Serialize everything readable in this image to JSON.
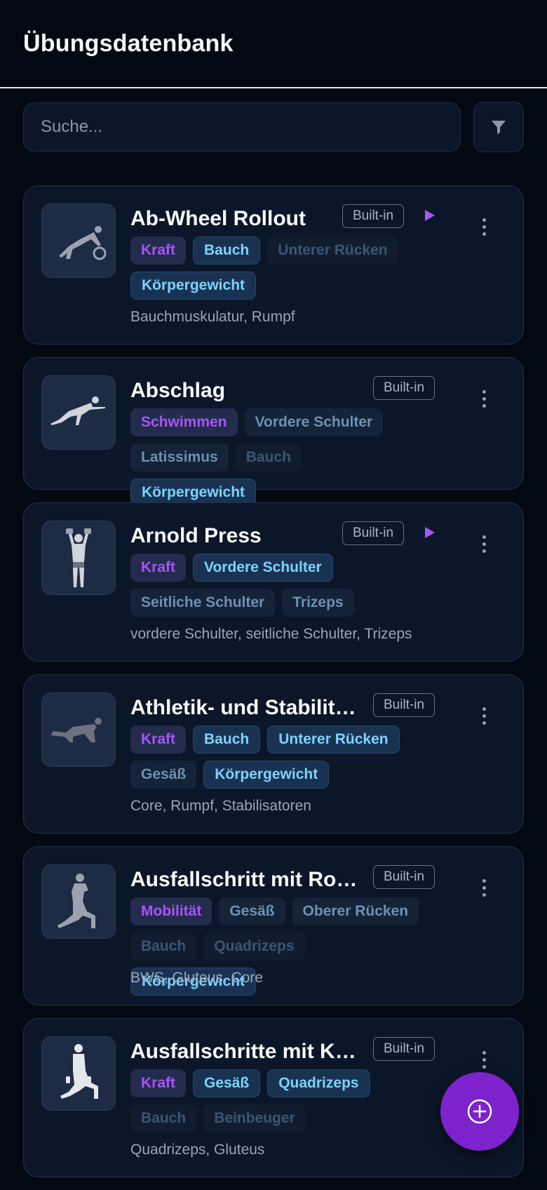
{
  "header": {
    "title": "Übungsdatenbank"
  },
  "search": {
    "placeholder": "Suche..."
  },
  "exercises": [
    {
      "name": "Ab-Wheel Rollout",
      "badge": "Built-in",
      "has_video": true,
      "tags": [
        {
          "label": "Kraft",
          "kind": "category"
        },
        {
          "label": "Bauch",
          "kind": "primary"
        },
        {
          "label": "Unterer Rücken",
          "kind": "tertiary"
        },
        {
          "label": "Körpergewicht",
          "kind": "primary"
        }
      ],
      "description": "Bauchmuskulatur, Rumpf",
      "icon": "ab-wheel-figure-icon"
    },
    {
      "name": "Abschlag",
      "badge": "Built-in",
      "has_video": false,
      "tags": [
        {
          "label": "Schwimmen",
          "kind": "category"
        },
        {
          "label": "Vordere Schulter",
          "kind": "secondary"
        },
        {
          "label": "Latissimus",
          "kind": "secondary"
        },
        {
          "label": "Bauch",
          "kind": "tertiary"
        },
        {
          "label": "Körpergewicht",
          "kind": "primary"
        }
      ],
      "description": "",
      "icon": "crawling-figure-icon"
    },
    {
      "name": "Arnold Press",
      "badge": "Built-in",
      "has_video": true,
      "tags": [
        {
          "label": "Kraft",
          "kind": "category"
        },
        {
          "label": "Vordere Schulter",
          "kind": "primary"
        },
        {
          "label": "Seitliche Schulter",
          "kind": "secondary"
        },
        {
          "label": "Trizeps",
          "kind": "secondary"
        }
      ],
      "description": "vordere Schulter, seitliche Schulter, Trizeps",
      "icon": "dumbbell-press-figure-icon"
    },
    {
      "name": "Athletik- und Stabilitätstraining",
      "badge": "Built-in",
      "has_video": false,
      "tags": [
        {
          "label": "Kraft",
          "kind": "category"
        },
        {
          "label": "Bauch",
          "kind": "primary"
        },
        {
          "label": "Unterer Rücken",
          "kind": "primary"
        },
        {
          "label": "Gesäß",
          "kind": "secondary"
        },
        {
          "label": "Körpergewicht",
          "kind": "primary"
        }
      ],
      "description": "Core, Rumpf, Stabilisatoren",
      "icon": "quadruped-figure-icon"
    },
    {
      "name": "Ausfallschritt mit Rotation",
      "badge": "Built-in",
      "has_video": false,
      "tags": [
        {
          "label": "Mobilität",
          "kind": "category"
        },
        {
          "label": "Gesäß",
          "kind": "secondary"
        },
        {
          "label": "Oberer Rücken",
          "kind": "secondary"
        },
        {
          "label": "Bauch",
          "kind": "tertiary"
        },
        {
          "label": "Quadrizeps",
          "kind": "tertiary"
        },
        {
          "label": "Körpergewicht",
          "kind": "primary"
        }
      ],
      "description": "BWS, Gluteus, Core",
      "icon": "lunge-rotation-figure-icon"
    },
    {
      "name": "Ausfallschritte mit Kurzhanteln",
      "badge": "Built-in",
      "has_video": false,
      "tags": [
        {
          "label": "Kraft",
          "kind": "category"
        },
        {
          "label": "Gesäß",
          "kind": "primary"
        },
        {
          "label": "Quadrizeps",
          "kind": "primary"
        },
        {
          "label": "Bauch",
          "kind": "tertiary"
        },
        {
          "label": "Beinbeuger",
          "kind": "tertiary"
        }
      ],
      "description": "Quadrizeps, Gluteus",
      "icon": "lunge-dumbbell-figure-icon"
    }
  ],
  "fab": {
    "icon": "plus-circle-icon"
  }
}
